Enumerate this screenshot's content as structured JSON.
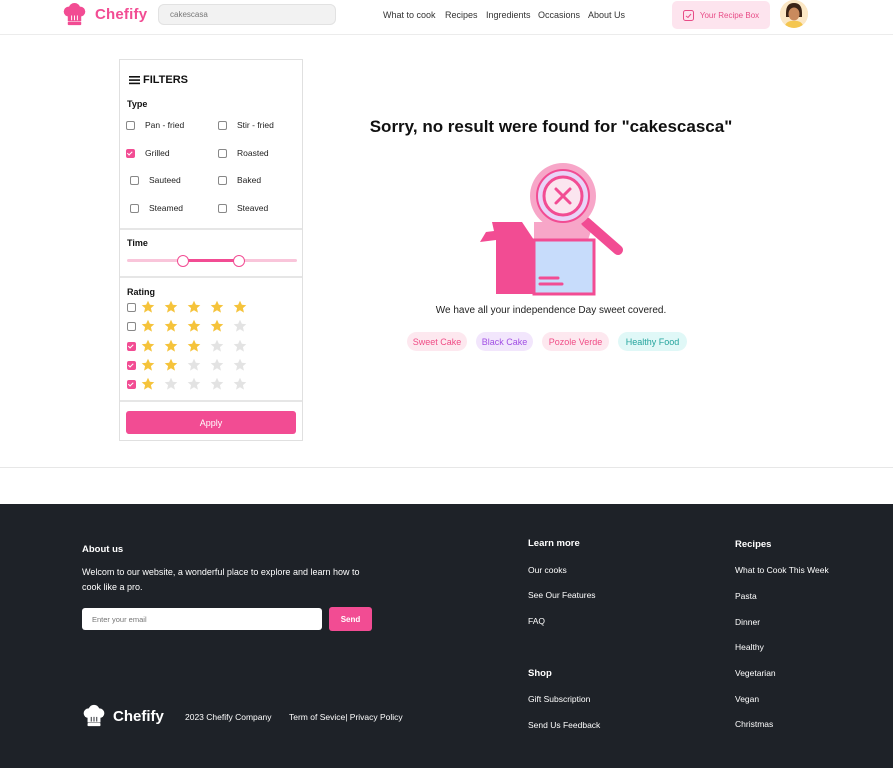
{
  "header": {
    "brand": "Chefify",
    "search_value": "cakescasa",
    "nav": [
      "What to cook",
      "Recipes",
      "Ingredients",
      "Occasions",
      "About Us"
    ],
    "recipe_box": "Your Recipe Box"
  },
  "filters": {
    "title": "FILTERS",
    "type_label": "Type",
    "types": [
      {
        "label": "Pan - fried",
        "checked": false
      },
      {
        "label": "Stir - fried",
        "checked": false
      },
      {
        "label": "Grilled",
        "checked": true
      },
      {
        "label": "Roasted",
        "checked": false
      },
      {
        "label": "Sauteed",
        "checked": false
      },
      {
        "label": "Baked",
        "checked": false
      },
      {
        "label": "Steamed",
        "checked": false
      },
      {
        "label": "Steaved",
        "checked": false
      }
    ],
    "time_label": "Time",
    "time_range": [
      0.33,
      0.66
    ],
    "rating_label": "Rating",
    "ratings": [
      {
        "stars": 5,
        "checked": false
      },
      {
        "stars": 4,
        "checked": false
      },
      {
        "stars": 3,
        "checked": true
      },
      {
        "stars": 2,
        "checked": true
      },
      {
        "stars": 1,
        "checked": true
      }
    ],
    "apply": "Apply"
  },
  "main": {
    "no_result": "Sorry, no result were found for \"cakescasca\"",
    "covered": "We have all your independence Day sweet covered.",
    "tags": [
      {
        "label": "Sweet Cake",
        "bg": "#fde8ef",
        "color": "#f04c86"
      },
      {
        "label": "Black Cake",
        "bg": "#f2e6fc",
        "color": "#a14fe4"
      },
      {
        "label": "Pozole Verde",
        "bg": "#fde8ef",
        "color": "#f04c86"
      },
      {
        "label": "Healthy Food",
        "bg": "#e0f8f7",
        "color": "#24a49d"
      }
    ]
  },
  "footer": {
    "about_title": "About us",
    "about_text_1": "Welcom to our website, a wonderful place to explore and learn how to",
    "about_text_2": "cook like a pro.",
    "email_placeholder": "Enter your email",
    "send": "Send",
    "brand": "Chefify",
    "company": "2023 Chefify Company",
    "terms": "Term of Sevice| Privacy Policy",
    "learn_title": "Learn more",
    "learn_links": [
      "Our cooks",
      "See Our Features",
      "FAQ"
    ],
    "shop_title": "Shop",
    "shop_links": [
      "Gift Subscription",
      "Send Us Feedback"
    ],
    "recipes_title": "Recipes",
    "recipes_links": [
      "What to Cook This Week",
      "Pasta",
      "Dinner",
      "Healthy",
      "Vegetarian",
      "Vegan",
      "Christmas"
    ]
  },
  "colors": {
    "accent": "#f24c93",
    "footer_bg": "#1e2228",
    "star_on": "#f5c33b",
    "star_off": "#e3e3e3"
  }
}
